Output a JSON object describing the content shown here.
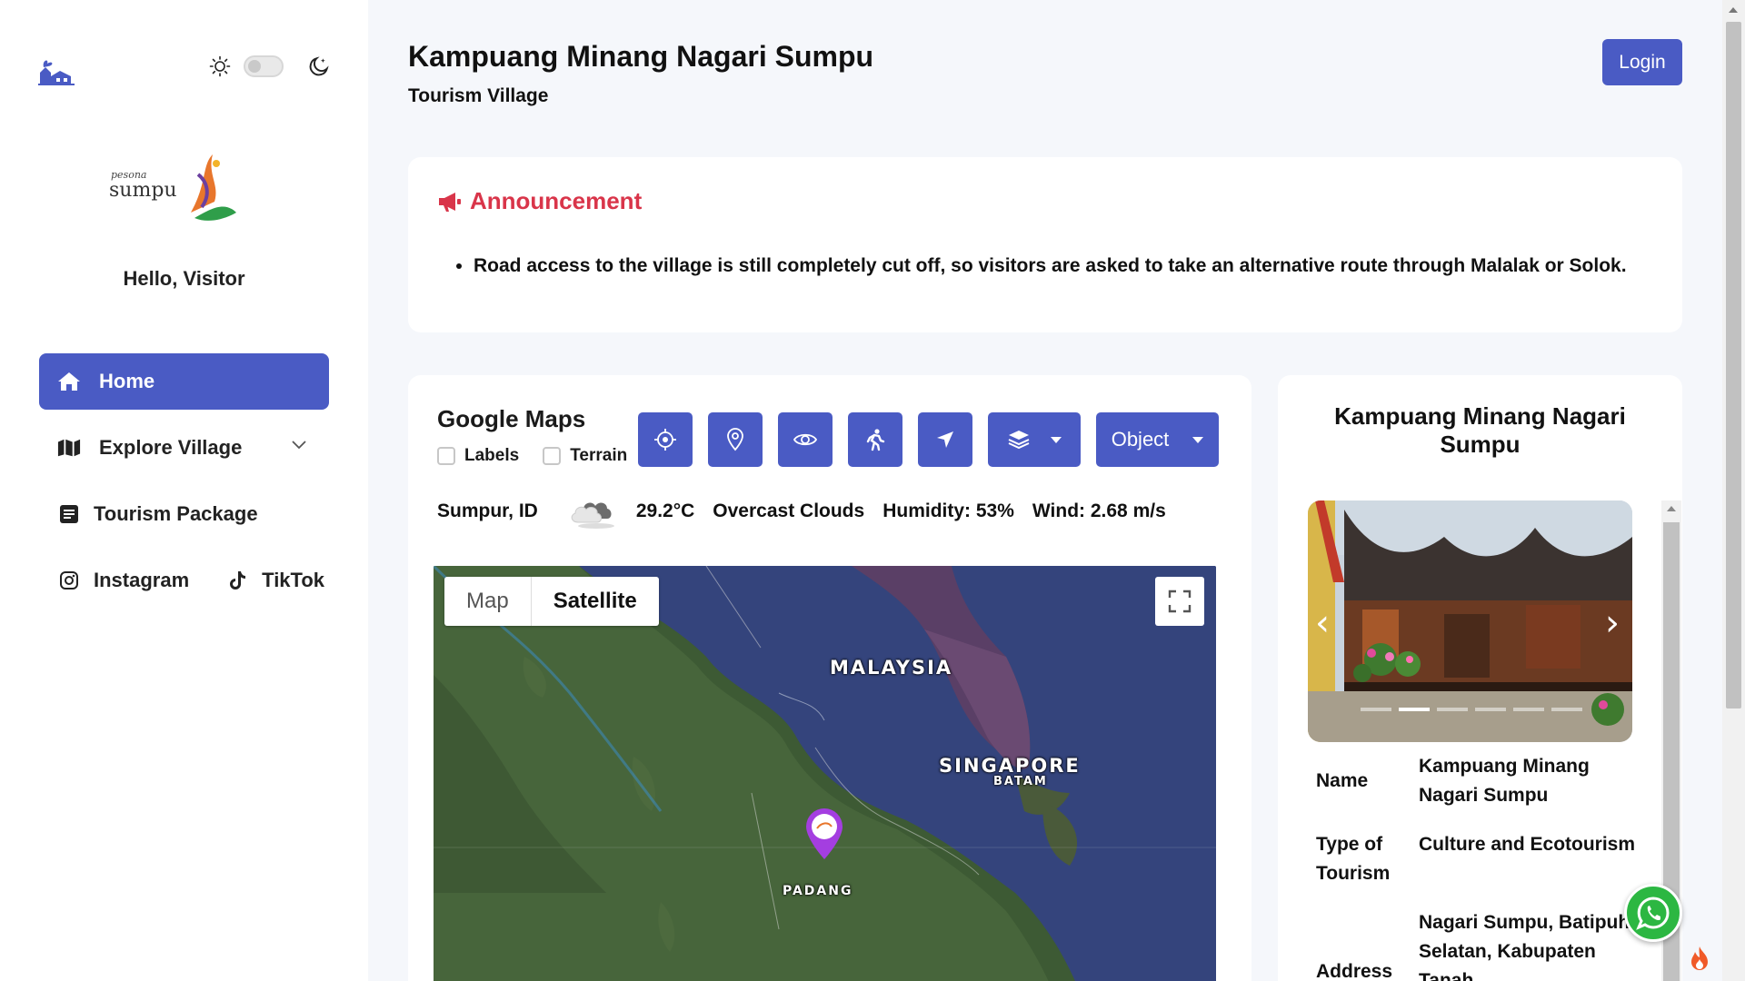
{
  "sidebar": {
    "greeting": "Hello, Visitor",
    "nav": [
      {
        "label": "Home",
        "icon": "home-icon",
        "active": true
      },
      {
        "label": "Explore Village",
        "icon": "map-icon",
        "expandable": true
      },
      {
        "label": "Tourism Package",
        "icon": "package-icon"
      }
    ],
    "social": [
      {
        "label": "Instagram",
        "icon": "instagram-icon"
      },
      {
        "label": "TikTok",
        "icon": "tiktok-icon"
      }
    ],
    "theme": {
      "dark_mode": false
    },
    "logo_text": "pesona sumpu"
  },
  "header": {
    "title": "Kampuang Minang Nagari Sumpu",
    "subtitle": "Tourism Village",
    "login_label": "Login"
  },
  "announcement": {
    "title": "Announcement",
    "items": [
      "Road access to the village is still completely cut off, so visitors are asked to take an alternative route through Malalak or Solok."
    ]
  },
  "maps": {
    "title": "Google Maps",
    "checkbox_labels": "Labels",
    "checkbox_terrain": "Terrain",
    "object_dropdown": "Object",
    "weather": {
      "location": "Sumpur, ID",
      "temperature": "29.2°C",
      "condition": "Overcast Clouds",
      "humidity": "Humidity: 53%",
      "wind": "Wind: 2.68 m/s"
    },
    "map_type_map": "Map",
    "map_type_satellite": "Satellite",
    "map_type_selected": "Satellite",
    "place_labels": {
      "malaysia": "MALAYSIA",
      "singapore": "SINGAPORE",
      "batam": "BATAM",
      "padang": "PADANG"
    }
  },
  "detail": {
    "title": "Kampuang Minang Nagari Sumpu",
    "carousel": {
      "slide_count": 6,
      "active_index": 1
    },
    "name_key": "Name",
    "name_val": "Kampuang Minang Nagari Sumpu",
    "type_key": "Type of Tourism",
    "type_val": "Culture and Ecotourism",
    "address_key": "Address",
    "address_val": "Nagari Sumpu, Batipuh Selatan, Kabupaten Tanah"
  },
  "colors": {
    "primary": "#4a5bc4",
    "announcement": "#d9354a",
    "whatsapp": "#2cb742"
  }
}
